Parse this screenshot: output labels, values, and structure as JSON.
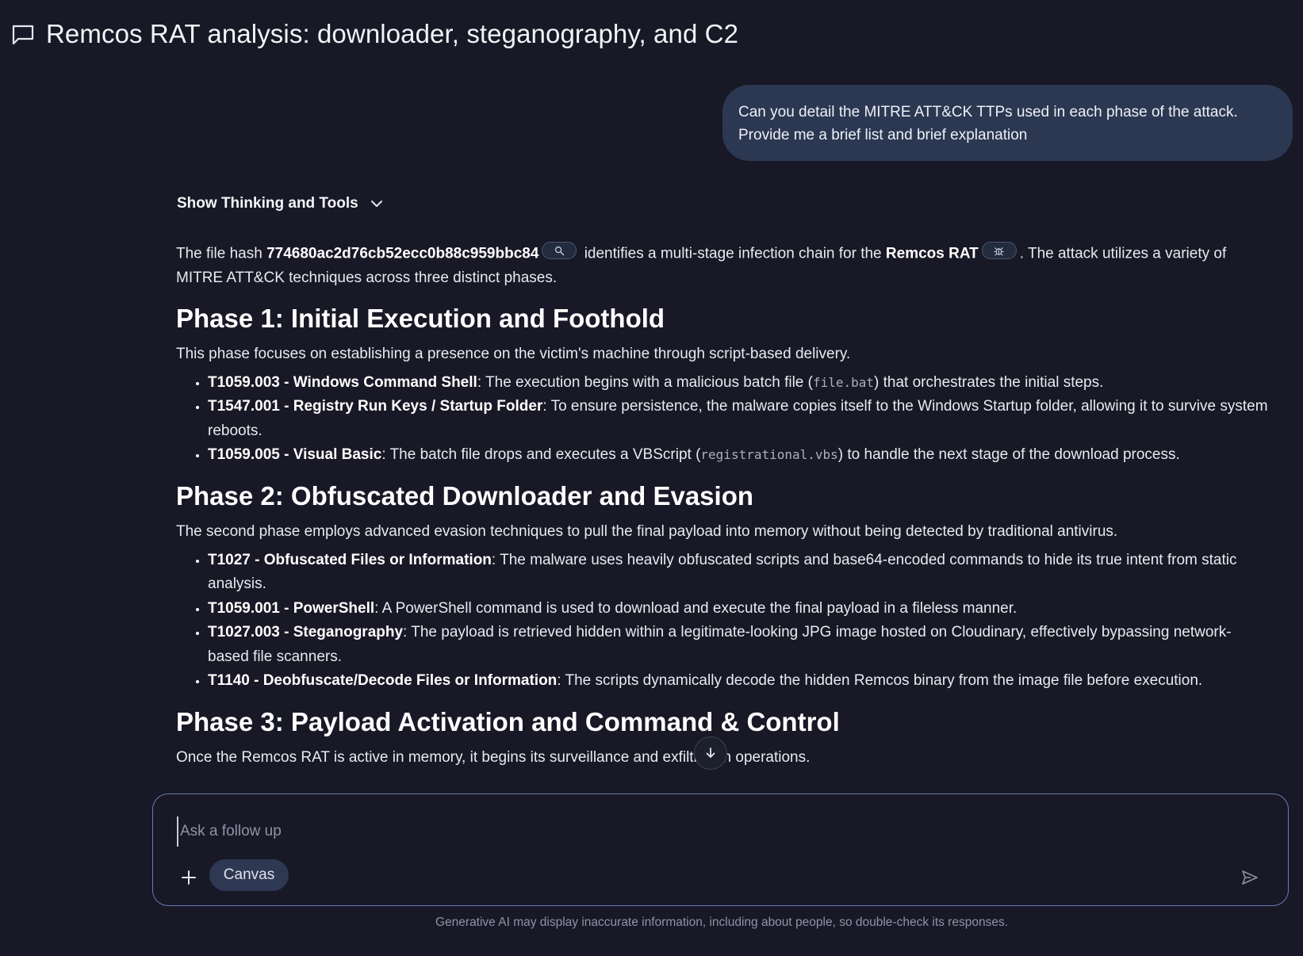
{
  "header": {
    "title": "Remcos RAT analysis: downloader, steganography, and C2",
    "icon": "chat-bubble-icon"
  },
  "user_message": "Can you detail the MITRE ATT&CK TTPs used in each phase of the attack. Provide me a brief list and brief explanation",
  "thinking_toggle": {
    "label": "Show Thinking and Tools",
    "icon": "chevron-down-icon"
  },
  "answer": {
    "intro": {
      "pre": "The file hash ",
      "hash": "774680ac2d76cb52ecc0b88c959bbc84",
      "mid": " identifies a multi-stage infection chain for the ",
      "malware": "Remcos RAT",
      "post": ". The attack utilizes a variety of MITRE ATT&CK techniques across three distinct phases."
    },
    "phases": [
      {
        "heading": "Phase 1: Initial Execution and Foothold",
        "description": "This phase focuses on establishing a presence on the victim's machine through script-based delivery.",
        "items": [
          {
            "id": "T1059.003 - Windows Command Shell",
            "pre": ": The execution begins with a malicious batch file (",
            "code": "file.bat",
            "post": ") that orchestrates the initial steps."
          },
          {
            "id": "T1547.001 - Registry Run Keys / Startup Folder",
            "pre": ": To ensure persistence, the malware copies itself to the Windows Startup folder, allowing it to survive system reboots.",
            "code": "",
            "post": ""
          },
          {
            "id": "T1059.005 - Visual Basic",
            "pre": ": The batch file drops and executes a VBScript (",
            "code": "registrational.vbs",
            "post": ") to handle the next stage of the download process."
          }
        ]
      },
      {
        "heading": "Phase 2: Obfuscated Downloader and Evasion",
        "description": "The second phase employs advanced evasion techniques to pull the final payload into memory without being detected by traditional antivirus.",
        "items": [
          {
            "id": "T1027 - Obfuscated Files or Information",
            "pre": ": The malware uses heavily obfuscated scripts and base64-encoded commands to hide its true intent from static analysis.",
            "code": "",
            "post": ""
          },
          {
            "id": "T1059.001 - PowerShell",
            "pre": ": A PowerShell command is used to download and execute the final payload in a fileless manner.",
            "code": "",
            "post": ""
          },
          {
            "id": "T1027.003 - Steganography",
            "pre": ": The payload is retrieved hidden within a legitimate-looking JPG image hosted on Cloudinary, effectively bypassing network-based file scanners.",
            "code": "",
            "post": ""
          },
          {
            "id": "T1140 - Deobfuscate/Decode Files or Information",
            "pre": ": The scripts dynamically decode the hidden Remcos binary from the image file before execution.",
            "code": "",
            "post": ""
          }
        ]
      },
      {
        "heading": "Phase 3: Payload Activation and Command & Control",
        "description": "Once the Remcos RAT is active in memory, it begins its surveillance and exfiltration operations.",
        "items": []
      }
    ]
  },
  "composer": {
    "placeholder": "Ask a follow up",
    "value": "",
    "canvas_label": "Canvas",
    "plus_icon": "plus-icon",
    "send_icon": "send-icon"
  },
  "disclaimer": "Generative AI may display inaccurate information, including about people, so double-check its responses."
}
